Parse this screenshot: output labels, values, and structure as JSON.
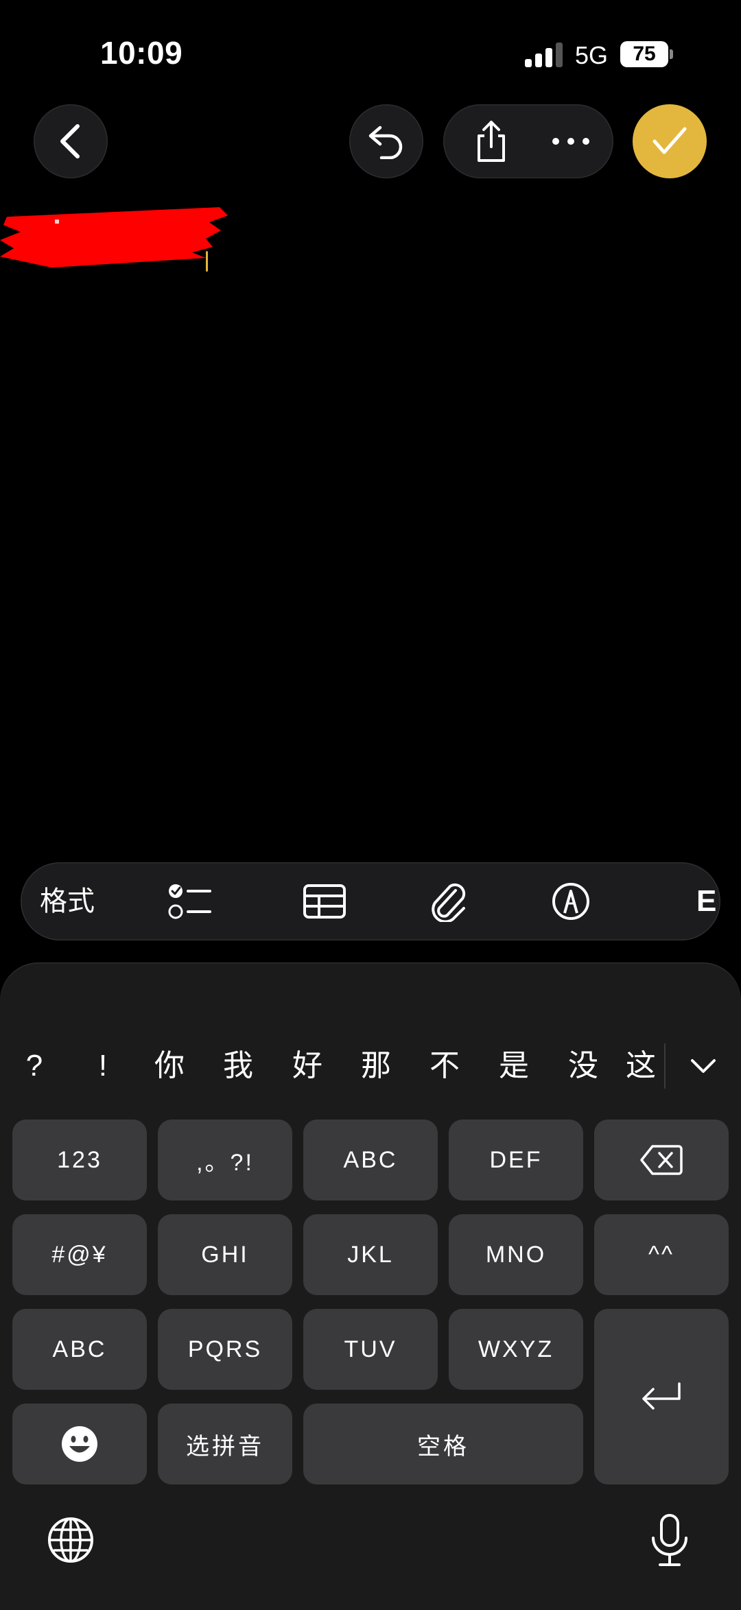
{
  "status_bar": {
    "time": "10:09",
    "network": "5G",
    "battery": "75"
  },
  "nav": {
    "back": "back-icon",
    "undo": "undo-icon",
    "share": "share-icon",
    "more": "more-icon",
    "done": "checkmark-icon"
  },
  "colors": {
    "accent": "#e3b73e",
    "background": "#000000",
    "keyboard": "#1b1b1b",
    "key": "#3a3a3c",
    "redaction": "#ff0000"
  },
  "toolbar": {
    "format_label": "格式",
    "tools": [
      "checklist-icon",
      "table-icon",
      "paperclip-icon",
      "markup-pen-icon"
    ]
  },
  "keyboard": {
    "candidates": [
      "?",
      "!",
      "你",
      "我",
      "好",
      "那",
      "不",
      "是",
      "没",
      "这"
    ],
    "keys": {
      "num": "123",
      "punct": ",。?!",
      "abc": "ABC",
      "def": "DEF",
      "symbols": "#@¥",
      "ghi": "GHI",
      "jkl": "JKL",
      "mno": "MNO",
      "emoticon": "^^",
      "abc2": "ABC",
      "pqrs": "PQRS",
      "tuv": "TUV",
      "wxyz": "WXYZ",
      "pinyin": "选拼音",
      "space": "空格"
    }
  }
}
